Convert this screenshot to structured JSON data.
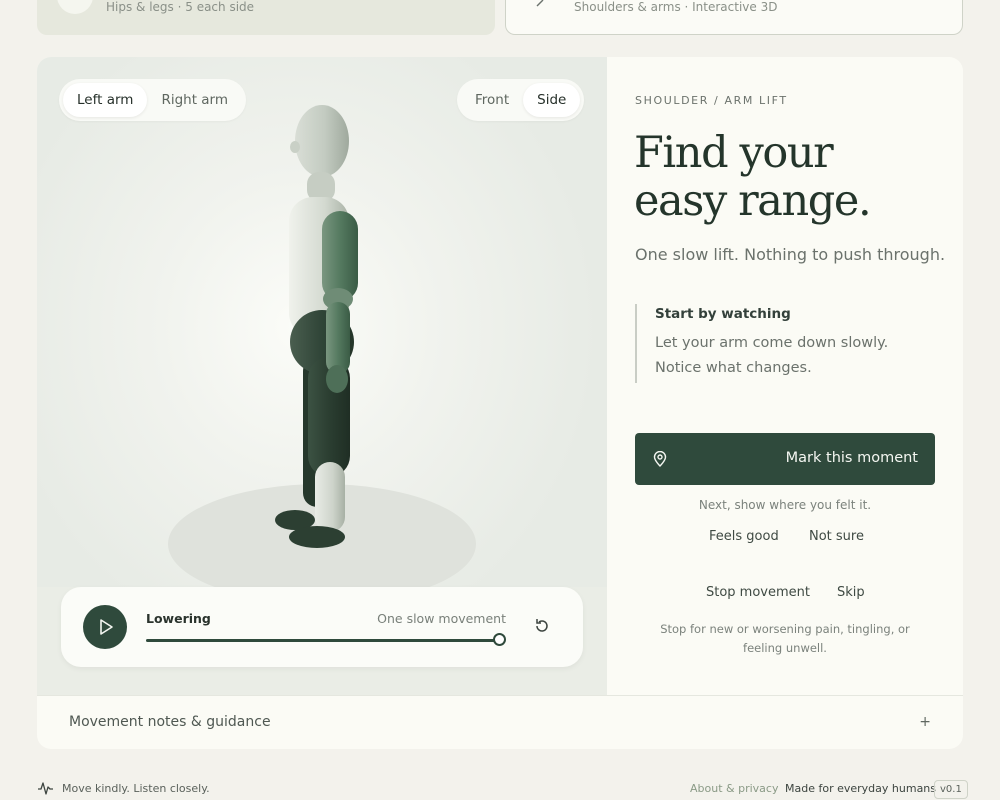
{
  "top_cards": {
    "left": {
      "subtitle": "Hips & legs · 5 each side",
      "icon": "pencil-icon"
    },
    "right": {
      "subtitle": "Shoulders & arms · Interactive 3D",
      "icon": "pencil-icon"
    }
  },
  "viewer": {
    "arm_toggle": {
      "options": [
        "Left arm",
        "Right arm"
      ],
      "selected": "Left arm"
    },
    "view_toggle": {
      "options": [
        "Front",
        "Side"
      ],
      "selected": "Side"
    },
    "player": {
      "phase": "Lowering",
      "hint": "One slow movement",
      "progress": 1.0,
      "play_icon": "play-icon",
      "reset_icon": "replay-icon"
    }
  },
  "panel": {
    "eyebrow": "SHOULDER / ARM LIFT",
    "headline_line1": "Find your",
    "headline_line2": "easy range.",
    "lede": "One slow lift. Nothing to push through.",
    "callout": {
      "title": "Start by watching",
      "body": "Let your arm come down slowly. Notice what changes."
    },
    "mark_button": {
      "label": "Mark this moment",
      "icon": "location-pin-icon"
    },
    "next_hint": "Next, show where you felt it.",
    "feel_good": "Feels good",
    "not_sure": "Not sure",
    "stop": "Stop movement",
    "skip": "Skip",
    "warning": "Stop for new or worsening pain, tingling, or feeling unwell."
  },
  "notes": {
    "label": "Movement notes & guidance",
    "toggle": "+"
  },
  "footer": {
    "tagline": "Move kindly. Listen closely.",
    "link": "About & privacy",
    "made": "Made for everyday humans",
    "version": "v0.1"
  },
  "colors": {
    "accent": "#2f4a3c",
    "background": "#f3f2ec",
    "card": "#fbfbf5",
    "muted_text": "#6b726c"
  }
}
